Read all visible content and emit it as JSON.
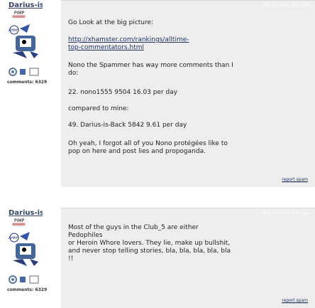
{
  "posts": [
    {
      "author": "Darius-is...",
      "rank": "PIMP",
      "stars": "xxxxxxx",
      "comments_label": "comments: 6329",
      "timestamp": "May 8, 2010, 3:27 pm",
      "lines": [
        "Go Look at the big picture:",
        "http://xhamster.com/rankings/alltime-",
        "top-commentators.html",
        "Nono the Spammer has way more comments than I",
        "do:",
        "22. nono1555 9504 16.03 per day",
        "compared to mine:",
        "49. Darius-is-Back 5842 9.61 per day",
        "Oh yeah, I forgot all of you Nono protégées like to",
        "pop on here and post lies and propoganda."
      ],
      "report_label": "report spam"
    },
    {
      "author": "Darius-is...",
      "rank": "PIMP",
      "stars": "xxxxxxx",
      "comments_label": "comments: 6329",
      "timestamp": "May 8, 2010, 3:25 pm",
      "lines": [
        "Most of the guys in the Club_5 are either",
        "Pedophiles",
        "or Heroin Whore lovers. They lie, make up bullshit,",
        "and never stop telling stories, bla, bla, bla, bla, bla",
        "!!"
      ],
      "report_label": "report spam"
    }
  ]
}
